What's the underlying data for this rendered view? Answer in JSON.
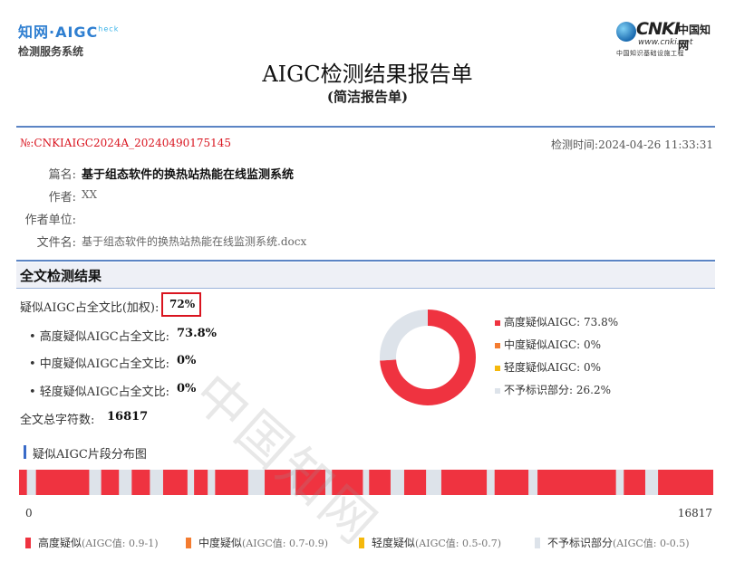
{
  "header": {
    "left_logo_line1": "知网·AIGC",
    "left_logo_sup": "heck",
    "left_logo_line2": "检测服务系统",
    "right_logo_brand": "CNKI",
    "right_logo_cn": "中国知网",
    "right_logo_url": "www.cnki.net",
    "right_logo_project": "中国知识基础设施工程",
    "title": "AIGC检测结果报告单",
    "subtitle": "(简洁报告单)"
  },
  "report": {
    "number": "№:CNKIAIGC2024A_20240490175145",
    "check_time": "检测时间:2024-04-26 11:33:31",
    "title_label": "篇名:",
    "title_value": "基于组态软件的换热站热能在线监测系统",
    "author_label": "作者:",
    "author_value": "XX",
    "unit_label": "作者单位:",
    "unit_value": "",
    "file_label": "文件名:",
    "file_value": "基于组态软件的换热站热能在线监测系统.docx"
  },
  "results": {
    "section_title": "全文检测结果",
    "weighted_label": "疑似AIGC占全文比(加权):",
    "weighted_value": "72%",
    "high_label": "• 高度疑似AIGC占全文比:",
    "high_value": "73.8%",
    "mid_label": "• 中度疑似AIGC占全文比:",
    "mid_value": "0%",
    "low_label": "• 轻度疑似AIGC占全文比:",
    "low_value": "0%",
    "total_label": "全文总字符数:",
    "total_value": "16817"
  },
  "chart_data": {
    "type": "pie",
    "style": "donut",
    "slices": [
      {
        "label": "高度疑似AIGC",
        "value": 73.8,
        "display": "高度疑似AIGC: 73.8%",
        "color": "#ef3340"
      },
      {
        "label": "中度疑似AIGC",
        "value": 0,
        "display": "中度疑似AIGC: 0%",
        "color": "#f47c30"
      },
      {
        "label": "轻度疑似AIGC",
        "value": 0,
        "display": "轻度疑似AIGC: 0%",
        "color": "#f5b80c"
      },
      {
        "label": "不予标识部分",
        "value": 26.2,
        "display": "不予标识部分: 26.2%",
        "color": "#dde3ea"
      }
    ],
    "legend_position": "right"
  },
  "distribution": {
    "title": "疑似AIGC片段分布图",
    "min_label": "0",
    "max_label": "16817",
    "total": 16817,
    "high_color": "#ef3340",
    "none_color": "#dde3ea",
    "high_segments": [
      [
        0,
        190
      ],
      [
        410,
        1700
      ],
      [
        1990,
        2420
      ],
      [
        2730,
        3170
      ],
      [
        3490,
        4080
      ],
      [
        4240,
        4570
      ],
      [
        4750,
        5550
      ],
      [
        5950,
        6580
      ],
      [
        6700,
        7420
      ],
      [
        7580,
        8330
      ],
      [
        8480,
        9000
      ],
      [
        9330,
        9860
      ],
      [
        10230,
        11330
      ],
      [
        11520,
        12340
      ],
      [
        12560,
        14460
      ],
      [
        14650,
        15170
      ],
      [
        15480,
        16817
      ]
    ],
    "legend": [
      {
        "name": "高度疑似",
        "range": "(AIGC值: 0.9-1)",
        "color": "#ef3340"
      },
      {
        "name": "中度疑似",
        "range": "(AIGC值: 0.7-0.9)",
        "color": "#f47c30"
      },
      {
        "name": "轻度疑似",
        "range": "(AIGC值: 0.5-0.7)",
        "color": "#f5b80c"
      },
      {
        "name": "不予标识部分",
        "range": "(AIGC值: 0-0.5)",
        "color": "#dde3ea"
      }
    ]
  },
  "watermark": "中国知网"
}
